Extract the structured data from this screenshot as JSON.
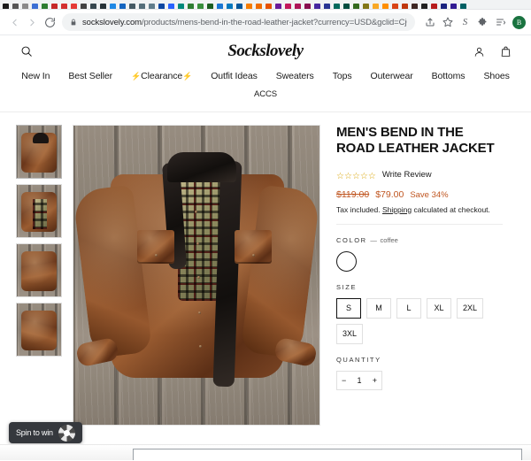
{
  "browser": {
    "nav": {
      "back_icon": "arrow-left-icon",
      "forward_icon": "arrow-right-icon",
      "reload_icon": "reload-icon"
    },
    "omnibox": {
      "lock_icon": "lock-icon",
      "domain": "sockslovely.com",
      "path": "/products/mens-bend-in-the-road-leather-jacket?currency=USD&gclid=Cj0...",
      "full_url": "sockslovely.com/products/mens-bend-in-the-road-leather-jacket?currency=USD&gclid=Cj0..."
    },
    "toolbar_icons": [
      "share-icon",
      "bookmark-star-icon",
      "s-extension-icon",
      "puzzle-extension-icon",
      "reading-list-icon"
    ],
    "profile_initial": "B",
    "profile_color": "#1a7340",
    "bookmark_favicon_colors": [
      "#1a1a1a",
      "#555555",
      "#8a8a8a",
      "#3b6fd4",
      "#2e7d32",
      "#c62828",
      "#d32f2f",
      "#e53935",
      "#424242",
      "#37474f",
      "#263238",
      "#1e88e5",
      "#1565c0",
      "#455a64",
      "#546e7a",
      "#607d8b",
      "#0d47a1",
      "#2962ff",
      "#00897b",
      "#2e7d32",
      "#388e3c",
      "#1b5e20",
      "#1976d2",
      "#0277bd",
      "#01579b",
      "#f57c00",
      "#ef6c00",
      "#e65100",
      "#6a1b9a",
      "#c2185b",
      "#ad1457",
      "#880e4f",
      "#4527a0",
      "#283593",
      "#00695c",
      "#004d40",
      "#33691e",
      "#827717",
      "#f9a825",
      "#ff8f00",
      "#d84315",
      "#bf360c",
      "#3e2723",
      "#212121",
      "#b71c1c",
      "#1a237e",
      "#311b92",
      "#006064"
    ]
  },
  "site": {
    "brand": "Sockslovely",
    "search_icon": "search-icon",
    "account_icon": "user-account-icon",
    "cart_icon": "shopping-bag-icon",
    "nav_primary": [
      {
        "label": "New In"
      },
      {
        "label": "Best Seller"
      },
      {
        "label": "Clearance",
        "badge": "⚡"
      },
      {
        "label": "Outfit Ideas"
      },
      {
        "label": "Sweaters"
      },
      {
        "label": "Tops"
      },
      {
        "label": "Outerwear"
      },
      {
        "label": "Bottoms"
      },
      {
        "label": "Shoes"
      }
    ],
    "nav_secondary": [
      {
        "label": "ACCS"
      }
    ]
  },
  "product": {
    "title": "MEN'S BEND IN THE ROAD LEATHER JACKET",
    "rating": {
      "stars": 0,
      "max_stars": 5,
      "star_glyph": "☆",
      "star_color": "#d9a300",
      "review_link": "Write Review"
    },
    "price": {
      "compare_at": "$119.00",
      "current": "$79.00",
      "save": "Save 34%",
      "color": "#c05621"
    },
    "tax_note_prefix": "Tax included. ",
    "tax_note_link": "Shipping",
    "tax_note_suffix": " calculated at checkout.",
    "color_option": {
      "label": "COLOR",
      "separator": "—",
      "value": "coffee",
      "swatches": [
        {
          "name": "coffee",
          "hex": "#ffffff",
          "selected": true
        }
      ]
    },
    "size_option": {
      "label": "SIZE",
      "options": [
        {
          "label": "S",
          "selected": true
        },
        {
          "label": "M",
          "selected": false
        },
        {
          "label": "L",
          "selected": false
        },
        {
          "label": "XL",
          "selected": false
        },
        {
          "label": "2XL",
          "selected": false
        },
        {
          "label": "3XL",
          "selected": false
        }
      ]
    },
    "quantity": {
      "label": "QUANTITY",
      "decrement": "−",
      "value": "1",
      "increment": "+"
    },
    "gallery": {
      "thumbnails": [
        {
          "name": "jacket-front-flat",
          "selected": true
        },
        {
          "name": "jacket-collar-detail",
          "selected": false
        },
        {
          "name": "jacket-zipper-detail",
          "selected": false
        },
        {
          "name": "jacket-pocket-detail",
          "selected": false
        }
      ],
      "main_image_alt": "Brown distressed leather jacket with plaid lining laid on weathered wood planks"
    }
  },
  "promo_widget": {
    "label": "Spin to win",
    "icon": "spin-wheel-icon"
  }
}
